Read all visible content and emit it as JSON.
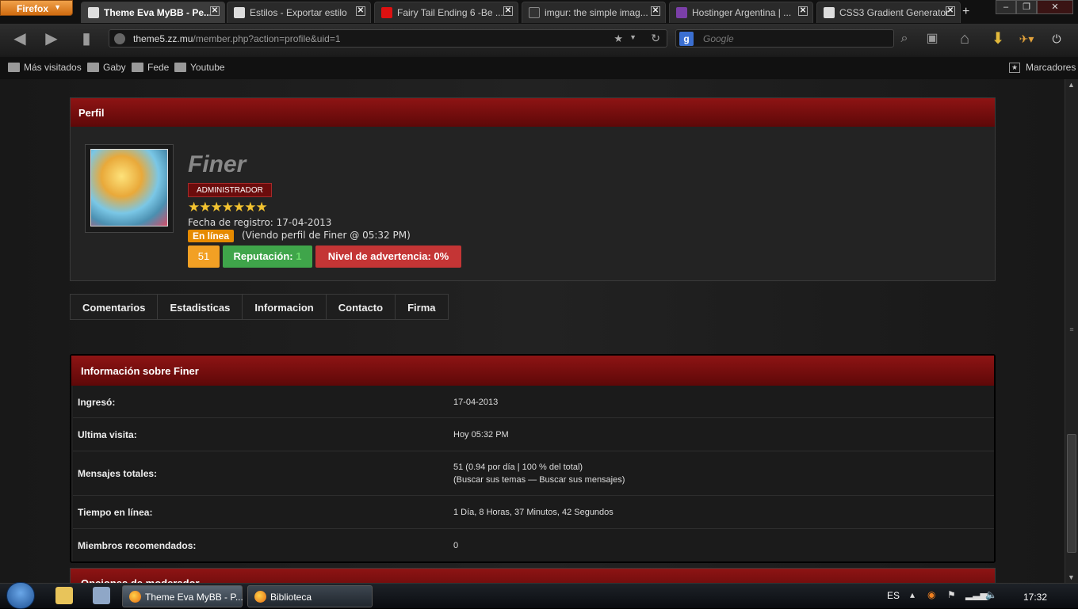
{
  "browser": {
    "app_button": "Firefox",
    "tabs": [
      {
        "label": "Theme Eva MyBB - Pe...",
        "active": true
      },
      {
        "label": "Estilos - Exportar estilo",
        "active": false
      },
      {
        "label": "Fairy Tail Ending 6 -Be ...",
        "active": false
      },
      {
        "label": "imgur: the simple imag...",
        "active": false
      },
      {
        "label": "Hostinger Argentina | ...",
        "active": false
      },
      {
        "label": "CSS3 Gradient Generator",
        "active": false
      }
    ],
    "url_domain": "theme5.zz.mu",
    "url_path": "/member.php?action=profile&uid=1",
    "search_placeholder": "Google",
    "bookmarks": [
      "Más visitados",
      "Gaby",
      "Fede",
      "Youtube"
    ],
    "bookmarks_menu": "Marcadores"
  },
  "profile": {
    "section_title": "Perfil",
    "username": "Finer",
    "role": "ADMINISTRADOR",
    "stars": "★★★★★★★",
    "registration": "Fecha de registro: 17-04-2013",
    "online_badge": "En línea",
    "viewing": "(Viendo perfil de Finer @ 05:32 PM)",
    "posts_count": "51",
    "reputation_label": "Reputación:",
    "reputation_value": "1",
    "warning": "Nivel de advertencia: 0%"
  },
  "profile_tabs": [
    "Comentarios",
    "Estadisticas",
    "Informacion",
    "Contacto",
    "Firma"
  ],
  "info": {
    "title": "Información sobre Finer",
    "rows": [
      {
        "label": "Ingresó:",
        "value": "17-04-2013",
        "value2": ""
      },
      {
        "label": "Ultima visita:",
        "value": "Hoy 05:32 PM",
        "value2": ""
      },
      {
        "label": "Mensajes totales:",
        "value": "51 (0.94 por día | 100 % del total)",
        "value2": "(Buscar sus temas — Buscar sus mensajes)"
      },
      {
        "label": "Tiempo en línea:",
        "value": "1 Día, 8 Horas, 37 Minutos, 42 Segundos",
        "value2": ""
      },
      {
        "label": "Miembros recomendados:",
        "value": "0",
        "value2": ""
      }
    ]
  },
  "moderator": {
    "title": "Opciones de moderador"
  },
  "taskbar": {
    "windows": [
      {
        "label": "Theme Eva MyBB - P..."
      },
      {
        "label": "Biblioteca"
      }
    ],
    "language": "ES",
    "clock": "17:32"
  },
  "colors": {
    "accent": "#8e1414",
    "online": "#e68a00",
    "reputation": "#3fa54a",
    "warning": "#c43535"
  }
}
